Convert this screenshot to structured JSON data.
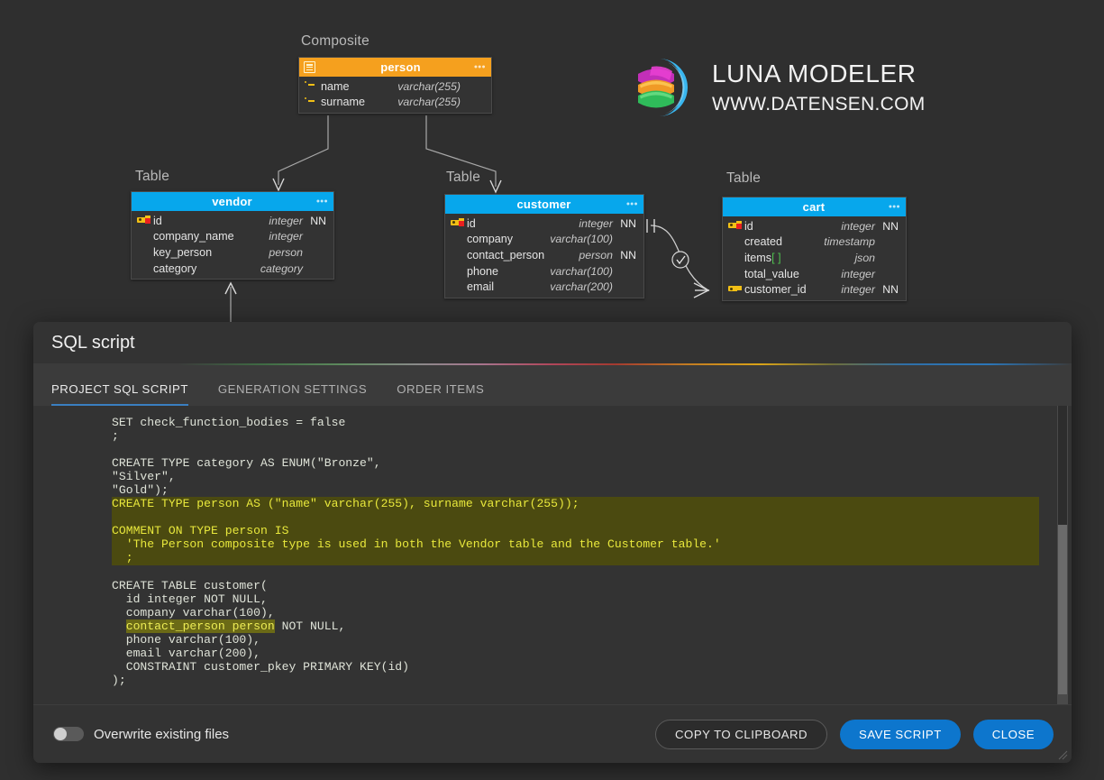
{
  "brand": {
    "name": "LUNA MODELER",
    "url": "WWW.DATENSEN.COM",
    "logo_icon": "luna-moon-logo"
  },
  "diagram": {
    "objects": [
      {
        "kind": "Composite",
        "kind_label": "Composite",
        "name": "person",
        "header_color": "#f5a01e",
        "menu": "•••",
        "attributes": [
          {
            "icon": "attribute-icon",
            "name": "name",
            "type": "varchar(255)",
            "nn": ""
          },
          {
            "icon": "attribute-icon",
            "name": "surname",
            "type": "varchar(255)",
            "nn": ""
          }
        ]
      },
      {
        "kind": "Table",
        "kind_label": "Table",
        "name": "vendor",
        "header_color": "#07a7ec",
        "menu": "•••",
        "attributes": [
          {
            "icon": "primary-key-icon",
            "name": "id",
            "type": "integer",
            "nn": "NN"
          },
          {
            "icon": "none",
            "name": "company_name",
            "type": "integer",
            "nn": ""
          },
          {
            "icon": "none",
            "name": "key_person",
            "type": "person",
            "nn": ""
          },
          {
            "icon": "none",
            "name": "category",
            "type": "category",
            "nn": ""
          }
        ]
      },
      {
        "kind": "Table",
        "kind_label": "Table",
        "name": "customer",
        "header_color": "#07a7ec",
        "menu": "•••",
        "attributes": [
          {
            "icon": "primary-key-icon",
            "name": "id",
            "type": "integer",
            "nn": "NN"
          },
          {
            "icon": "none",
            "name": "company",
            "type": "varchar(100)",
            "nn": ""
          },
          {
            "icon": "none",
            "name": "contact_person",
            "type": "person",
            "nn": "NN"
          },
          {
            "icon": "none",
            "name": "phone",
            "type": "varchar(100)",
            "nn": ""
          },
          {
            "icon": "none",
            "name": "email",
            "type": "varchar(200)",
            "nn": ""
          }
        ]
      },
      {
        "kind": "Table",
        "kind_label": "Table",
        "name": "cart",
        "header_color": "#07a7ec",
        "menu": "•••",
        "attributes": [
          {
            "icon": "primary-key-icon",
            "name": "id",
            "type": "integer",
            "nn": "NN"
          },
          {
            "icon": "none",
            "name": "created",
            "type": "timestamp",
            "nn": ""
          },
          {
            "icon": "none",
            "name": "items",
            "array_suffix": "[ ]",
            "type": "json",
            "nn": ""
          },
          {
            "icon": "none",
            "name": "total_value",
            "type": "integer",
            "nn": ""
          },
          {
            "icon": "foreign-key-icon",
            "name": "customer_id",
            "type": "integer",
            "nn": "NN"
          }
        ]
      }
    ]
  },
  "dialog": {
    "title": "SQL script",
    "tabs": [
      {
        "label": "PROJECT SQL SCRIPT",
        "active": true
      },
      {
        "label": "GENERATION SETTINGS",
        "active": false
      },
      {
        "label": "ORDER ITEMS",
        "active": false
      }
    ],
    "script": {
      "part1": "SET check_function_bodies = false\n;\n\nCREATE TYPE category AS ENUM(\"Bronze\",\n\"Silver\",\n\"Gold\");\n",
      "part2_highlighted": "CREATE TYPE person AS (\"name\" varchar(255), surname varchar(255));\n\nCOMMENT ON TYPE person IS\n  'The Person composite type is used in both the Vendor table and the Customer table.'\n  ;\n",
      "part3_pre": "\nCREATE TABLE customer(\n  id integer NOT NULL,\n  company varchar(100),\n  ",
      "part3_inline_highlight": "contact_person person",
      "part3_post": " NOT NULL,\n  phone varchar(100),\n  email varchar(200),\n  CONSTRAINT customer_pkey PRIMARY KEY(id)\n);"
    },
    "footer": {
      "toggle_label": "Overwrite existing files",
      "toggle_state": "off",
      "buttons": [
        {
          "label": "COPY TO CLIPBOARD",
          "style": "ghost"
        },
        {
          "label": "SAVE SCRIPT",
          "style": "primary"
        },
        {
          "label": "CLOSE",
          "style": "primary"
        }
      ]
    },
    "accent_color": "#0d76cd",
    "tab_underline_color": "#3a7fc1"
  }
}
